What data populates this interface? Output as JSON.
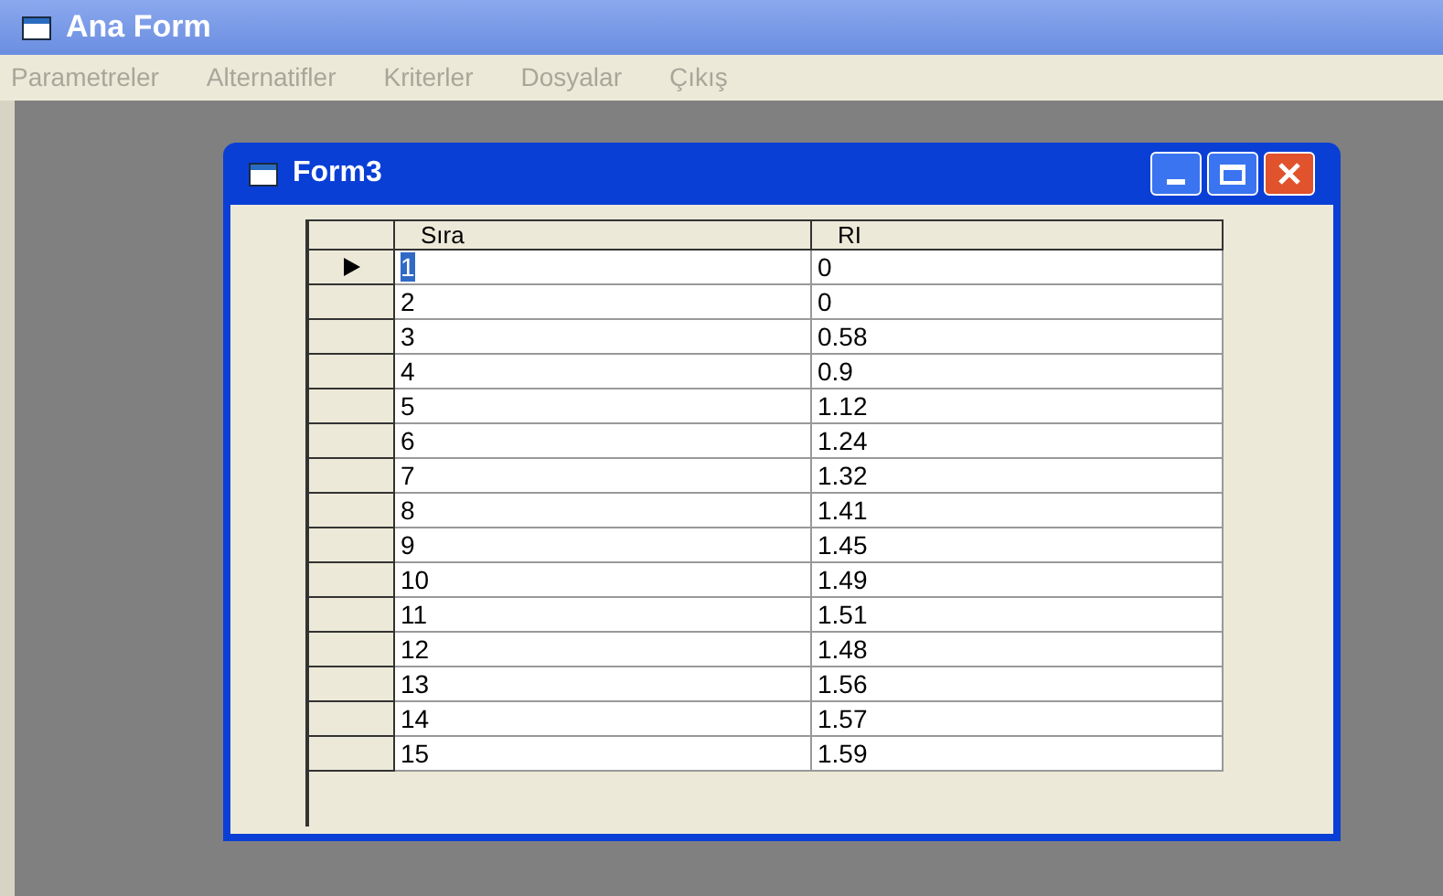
{
  "window": {
    "title": "Ana Form"
  },
  "menu": [
    {
      "label": "Parametreler",
      "disabled": true
    },
    {
      "label": "Alternatifler",
      "disabled": true
    },
    {
      "label": "Kriterler",
      "disabled": true
    },
    {
      "label": "Dosyalar",
      "disabled": true
    },
    {
      "label": "Çıkış",
      "disabled": true
    }
  ],
  "child_window": {
    "title": "Form3",
    "table": {
      "columns": [
        "Sıra",
        "RI"
      ],
      "rows": [
        {
          "cells": [
            "1",
            "0"
          ],
          "selected": true
        },
        {
          "cells": [
            "2",
            "0"
          ],
          "selected": false
        },
        {
          "cells": [
            "3",
            "0.58"
          ],
          "selected": false
        },
        {
          "cells": [
            "4",
            "0.9"
          ],
          "selected": false
        },
        {
          "cells": [
            "5",
            "1.12"
          ],
          "selected": false
        },
        {
          "cells": [
            "6",
            "1.24"
          ],
          "selected": false
        },
        {
          "cells": [
            "7",
            "1.32"
          ],
          "selected": false
        },
        {
          "cells": [
            "8",
            "1.41"
          ],
          "selected": false
        },
        {
          "cells": [
            "9",
            "1.45"
          ],
          "selected": false
        },
        {
          "cells": [
            "10",
            "1.49"
          ],
          "selected": false
        },
        {
          "cells": [
            "11",
            "1.51"
          ],
          "selected": false
        },
        {
          "cells": [
            "12",
            "1.48"
          ],
          "selected": false
        },
        {
          "cells": [
            "13",
            "1.56"
          ],
          "selected": false
        },
        {
          "cells": [
            "14",
            "1.57"
          ],
          "selected": false
        },
        {
          "cells": [
            "15",
            "1.59"
          ],
          "selected": false
        }
      ]
    }
  }
}
